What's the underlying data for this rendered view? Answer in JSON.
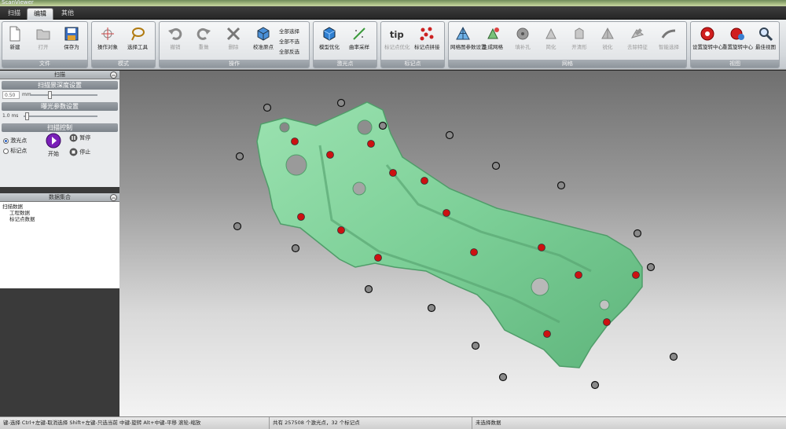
{
  "window": {
    "title": "ScanViewer"
  },
  "tabs": [
    {
      "label": "扫描",
      "active": false
    },
    {
      "label": "编辑",
      "active": true
    },
    {
      "label": "其他",
      "active": false
    }
  ],
  "ribbon": {
    "file": {
      "title": "文件",
      "new": "新建",
      "open": "打开",
      "save_as": "保存为"
    },
    "mode": {
      "title": "模式",
      "op_target": "操作对象",
      "select_tool": "选择工具"
    },
    "ops": {
      "title": "操作",
      "undo": "撤销",
      "redo": "重做",
      "delete": "删除",
      "calib_origin": "校准原点",
      "select_all": "全部选择",
      "select_none": "全部不选",
      "invert": "全部反选"
    },
    "laser": {
      "title": "激光点",
      "model_opt": "模型优化",
      "curvature_sample": "曲率采样"
    },
    "marker": {
      "title": "标记点",
      "marker_opt": "标记点优化",
      "marker_stitch": "标记点拼接"
    },
    "mesh": {
      "title": "网格",
      "mesh_params": "网格图参数设置",
      "gen_mesh": "生成网格",
      "fill_holes": "填补孔",
      "simplify": "简化",
      "open_shape": "开清形",
      "sharpen": "锐化",
      "remove_feature": "去除特征",
      "smart_select": "智能选择"
    },
    "view": {
      "title": "视图",
      "set_rot_center": "设置旋转中心",
      "reset_rot_center": "重置旋转中心",
      "best_view": "最佳视图"
    }
  },
  "left_panel": {
    "scan_title": "扫描",
    "depth_title": "扫描景深度设置",
    "depth_value": "0.50",
    "depth_unit": "mm",
    "depth_fraction": 0.3,
    "exposure_title": "曝光参数设置",
    "exposure_value": "1.0 ms",
    "exposure_fraction": 0.05,
    "control_title": "扫描控制",
    "radio_laser": "激光点",
    "radio_marker": "标记点",
    "start": "开始",
    "pause": "暂停",
    "stop": "停止",
    "data_title": "数据集合",
    "tree_root": "扫描数据",
    "tree_child1": "工程数据",
    "tree_child2": "标记点数据"
  },
  "status": {
    "hint": "键-选择 Ctrl+左键-取消选择 Shift+左键-只选当前 中键-旋转 Alt+中键-平移 滚轮-缩放",
    "points": "共有 257508 个激光点，32 个标记点",
    "selection": "未选择数据"
  },
  "colors": {
    "model": "#7fd39a",
    "marker_red": "#cc1111",
    "ribbon_group_title": "#8e959c"
  }
}
